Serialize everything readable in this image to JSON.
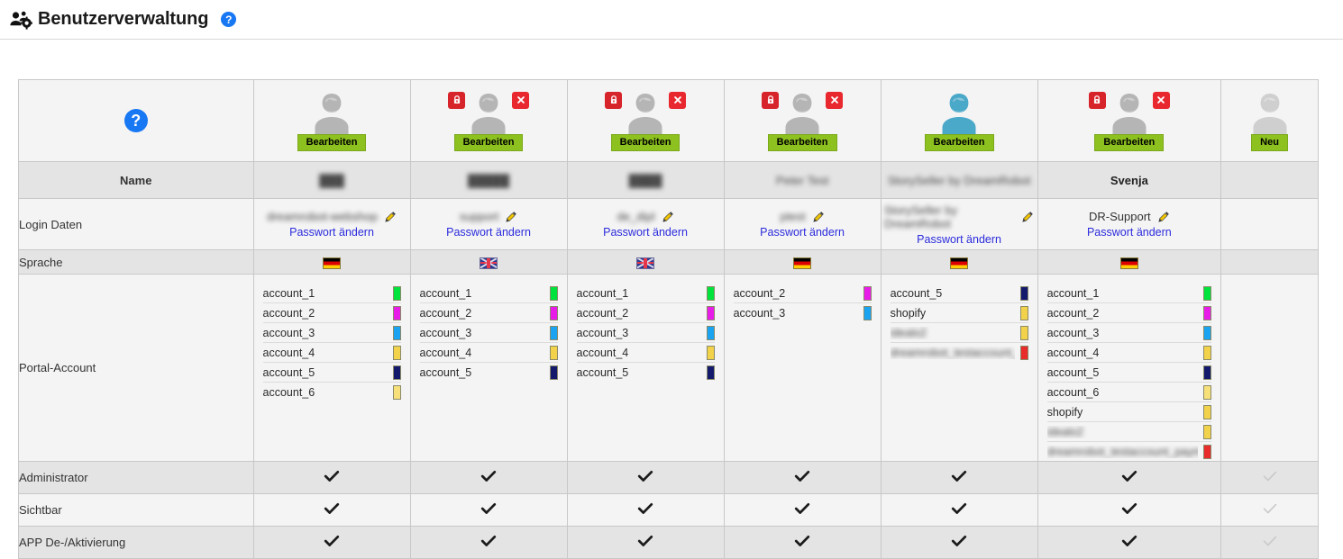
{
  "header": {
    "icon": "users-gear-icon",
    "title": "Benutzerverwaltung",
    "help_label": "?"
  },
  "colors": {
    "accent_green": "#8cc11f",
    "link_blue": "#2b2bdd",
    "help_blue": "#1877f2",
    "lock_red": "#d7232a",
    "delete_red": "#e8272e",
    "avatar_gray": "#b5b5b5",
    "avatar_blue": "#4aa8c8",
    "row_dark": "#e4e4e4",
    "row_light": "#f4f4f4"
  },
  "chip_colors": {
    "green": "#00e33c",
    "magenta": "#e81ce8",
    "lightblue": "#1aa3f0",
    "gold": "#f2d24a",
    "navy": "#131a6b",
    "paleyellow": "#f7e07a",
    "red": "#e82b2b"
  },
  "table": {
    "help_column": {
      "icon": "help-circle-icon"
    },
    "row_labels": {
      "name": "Name",
      "login": "Login Daten",
      "sprache": "Sprache",
      "portal": "Portal-Account",
      "administrator": "Administrator",
      "sichtbar": "Sichtbar",
      "app": "APP De-/Aktivierung"
    },
    "edit_button_label": "Bearbeiten",
    "new_button_label": "Neu",
    "password_link_label": "Passwort ändern",
    "users": [
      {
        "avatar_color": "gray",
        "has_lock": false,
        "has_delete": false,
        "name": "███",
        "name_redacted": true,
        "login": "dreamrobot-webshop",
        "login_redacted": true,
        "language": "de",
        "accounts": [
          {
            "label": "account_1",
            "color": "green",
            "redacted": false
          },
          {
            "label": "account_2",
            "color": "magenta",
            "redacted": false
          },
          {
            "label": "account_3",
            "color": "lightblue",
            "redacted": false
          },
          {
            "label": "account_4",
            "color": "gold",
            "redacted": false
          },
          {
            "label": "account_5",
            "color": "navy",
            "redacted": false
          },
          {
            "label": "account_6",
            "color": "paleyellow",
            "redacted": false
          }
        ],
        "administrator": true,
        "sichtbar": true,
        "app": true
      },
      {
        "avatar_color": "gray",
        "has_lock": true,
        "has_delete": true,
        "name": "█████",
        "name_redacted": true,
        "login": "support",
        "login_redacted": true,
        "language": "gb",
        "accounts": [
          {
            "label": "account_1",
            "color": "green",
            "redacted": false
          },
          {
            "label": "account_2",
            "color": "magenta",
            "redacted": false
          },
          {
            "label": "account_3",
            "color": "lightblue",
            "redacted": false
          },
          {
            "label": "account_4",
            "color": "gold",
            "redacted": false
          },
          {
            "label": "account_5",
            "color": "navy",
            "redacted": false
          }
        ],
        "administrator": true,
        "sichtbar": true,
        "app": true
      },
      {
        "avatar_color": "gray",
        "has_lock": true,
        "has_delete": true,
        "name": "████",
        "name_redacted": true,
        "login": "de_dipl",
        "login_redacted": true,
        "language": "gb",
        "accounts": [
          {
            "label": "account_1",
            "color": "green",
            "redacted": false
          },
          {
            "label": "account_2",
            "color": "magenta",
            "redacted": false
          },
          {
            "label": "account_3",
            "color": "lightblue",
            "redacted": false
          },
          {
            "label": "account_4",
            "color": "gold",
            "redacted": false
          },
          {
            "label": "account_5",
            "color": "navy",
            "redacted": false
          }
        ],
        "administrator": true,
        "sichtbar": true,
        "app": true
      },
      {
        "avatar_color": "gray",
        "has_lock": true,
        "has_delete": true,
        "name": "Peter Test",
        "name_redacted": true,
        "login": "ptest",
        "login_redacted": true,
        "language": "de",
        "accounts": [
          {
            "label": "account_2",
            "color": "magenta",
            "redacted": false
          },
          {
            "label": "account_3",
            "color": "lightblue",
            "redacted": false
          }
        ],
        "administrator": true,
        "sichtbar": true,
        "app": true
      },
      {
        "avatar_color": "blue",
        "has_lock": false,
        "has_delete": false,
        "name": "StorySeller by DreamRobot",
        "name_redacted": true,
        "login": "StorySeller by DreamRobot",
        "login_redacted": true,
        "language": "de",
        "accounts": [
          {
            "label": "account_5",
            "color": "navy",
            "redacted": false
          },
          {
            "label": "shopify",
            "color": "gold",
            "redacted": false
          },
          {
            "label": "idealo2",
            "color": "gold",
            "redacted": true
          },
          {
            "label": "dreamrobot_testaccount_payments",
            "color": "red",
            "redacted": true
          }
        ],
        "administrator": true,
        "sichtbar": true,
        "app": true
      },
      {
        "avatar_color": "gray",
        "has_lock": true,
        "has_delete": true,
        "name": "Svenja",
        "name_redacted": false,
        "login": "DR-Support",
        "login_redacted": false,
        "language": "de",
        "accounts": [
          {
            "label": "account_1",
            "color": "green",
            "redacted": false
          },
          {
            "label": "account_2",
            "color": "magenta",
            "redacted": false
          },
          {
            "label": "account_3",
            "color": "lightblue",
            "redacted": false
          },
          {
            "label": "account_4",
            "color": "gold",
            "redacted": false
          },
          {
            "label": "account_5",
            "color": "navy",
            "redacted": false
          },
          {
            "label": "account_6",
            "color": "paleyellow",
            "redacted": false
          },
          {
            "label": "shopify",
            "color": "gold",
            "redacted": false
          },
          {
            "label": "idealo2",
            "color": "gold",
            "redacted": true
          },
          {
            "label": "dreamrobot_testaccount_payments",
            "color": "red",
            "redacted": true
          }
        ],
        "administrator": true,
        "sichtbar": true,
        "app": true
      }
    ],
    "new_column": {
      "avatar_color": "lightgray",
      "name": "",
      "administrator_disabled": true,
      "sichtbar_disabled": true,
      "app_disabled": true
    }
  }
}
